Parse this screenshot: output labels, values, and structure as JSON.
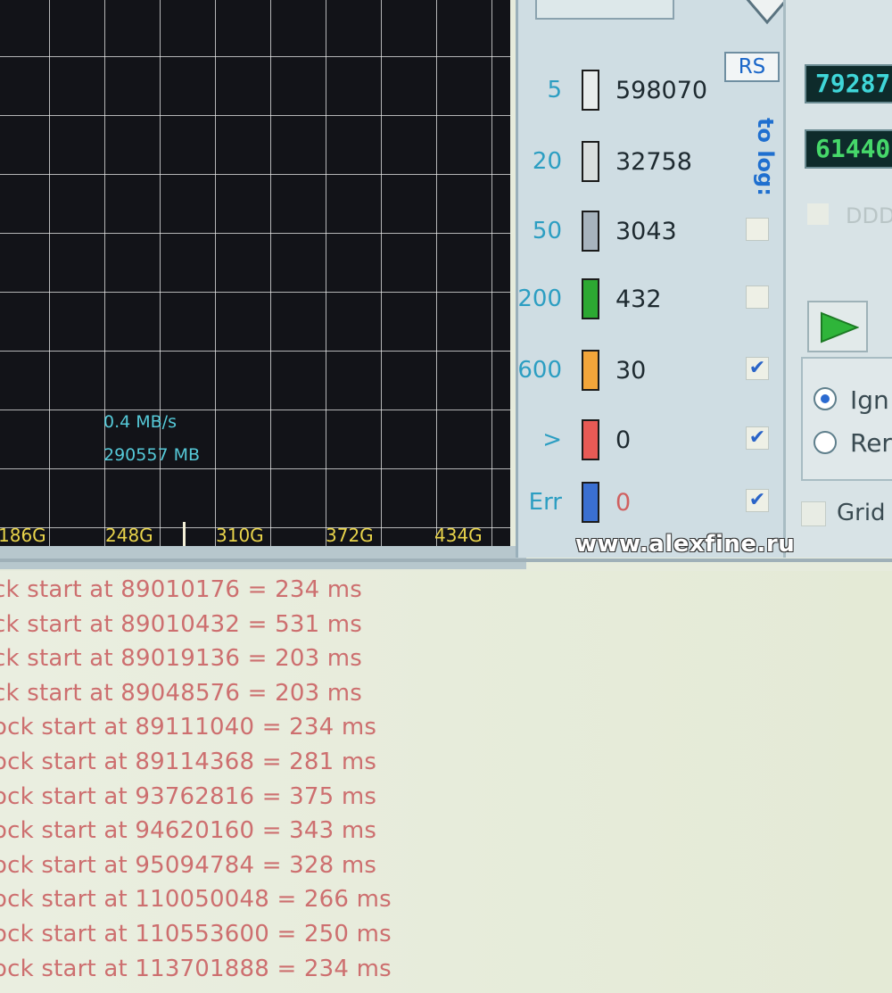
{
  "graph": {
    "speed": "0.4 MB/s",
    "position": "290557 MB",
    "axis_ticks": [
      "186G",
      "248G",
      "310G",
      "372G",
      "434G"
    ]
  },
  "legend": {
    "rs_button": "RS",
    "to_log_label": "to log:",
    "rows": [
      {
        "threshold": "5",
        "count": "598070",
        "color": "#e8ecec",
        "logged": false,
        "has_checkbox": false
      },
      {
        "threshold": "20",
        "count": "32758",
        "color": "#d9dede",
        "logged": false,
        "has_checkbox": false
      },
      {
        "threshold": "50",
        "count": "3043",
        "color": "#a7b3bd",
        "logged": false,
        "has_checkbox": true
      },
      {
        "threshold": "200",
        "count": "432",
        "color": "#2da832",
        "logged": false,
        "has_checkbox": true
      },
      {
        "threshold": "600",
        "count": "30",
        "color": "#f2a53a",
        "logged": true,
        "has_checkbox": true
      },
      {
        "threshold": ">",
        "count": "0",
        "color": "#e85a55",
        "logged": true,
        "has_checkbox": true
      },
      {
        "threshold": "Err",
        "count": "0",
        "color": "#3a6fd1",
        "logged": true,
        "has_checkbox": true
      }
    ]
  },
  "right_panel": {
    "counter1": "79287",
    "counter2": "61440",
    "ddd_label": "DDD",
    "radio_options": [
      {
        "label": "Ign",
        "selected": true
      },
      {
        "label": "Rer",
        "selected": false
      }
    ],
    "grid_label": "Grid"
  },
  "watermark": "www.alexfine.ru",
  "log": [
    "ck start at 89010176 = 234 ms",
    "ck start at 89010432 = 531 ms",
    "ck start at 89019136 = 203 ms",
    "ck start at 89048576 = 203 ms",
    "ock start at 89111040 = 234 ms",
    "ock start at 89114368 = 281 ms",
    "ock start at 93762816 = 375 ms",
    "ock start at 94620160 = 343 ms",
    "ock start at 95094784 = 328 ms",
    "ock start at 110050048 = 266 ms",
    "ock start at 110553600 = 250 ms",
    "ock start at 113701888 = 234 ms"
  ]
}
